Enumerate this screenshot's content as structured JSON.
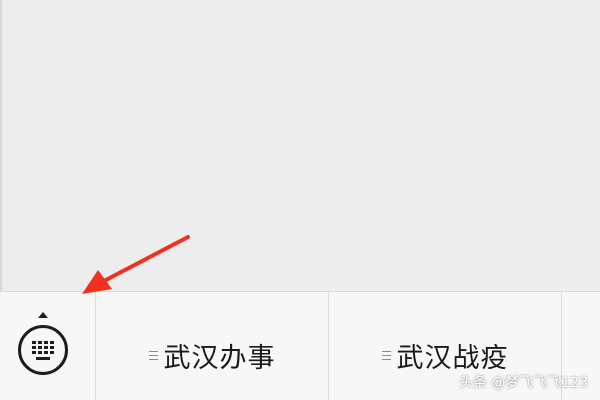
{
  "bottom_menu": {
    "keyboard_icon": "keyboard-icon",
    "items": [
      {
        "label": "武汉办事"
      },
      {
        "label": "武汉战疫"
      }
    ]
  },
  "watermark": {
    "text": "头条 @梦飞飞飞123"
  },
  "colors": {
    "background": "#ededed",
    "bar": "#f7f7f7",
    "arrow": "#f0311f",
    "text": "#1a1a1a"
  }
}
